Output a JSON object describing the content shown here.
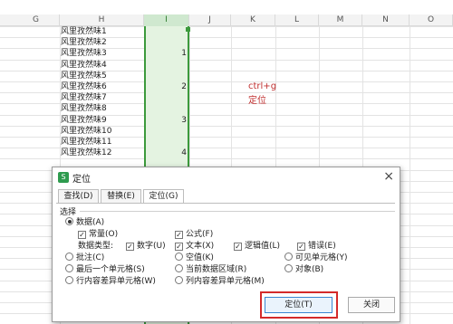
{
  "columns": [
    "G",
    "H",
    "I",
    "J",
    "K",
    "L",
    "M",
    "N",
    "O"
  ],
  "selected_column": "I",
  "h_cells": [
    "风里孜然味1",
    "风里孜然味2",
    "风里孜然味3",
    "风里孜然味4",
    "风里孜然味5",
    "风里孜然味6",
    "风里孜然味7",
    "风里孜然味8",
    "风里孜然味9",
    "风里孜然味10",
    "风里孜然味11",
    "风里孜然味12"
  ],
  "i_cells": [
    {
      "row": 3,
      "value": "1"
    },
    {
      "row": 6,
      "value": "2"
    },
    {
      "row": 9,
      "value": "3"
    },
    {
      "row": 12,
      "value": "4"
    }
  ],
  "notes": [
    "ctrl+g",
    "定位"
  ],
  "dialog": {
    "title": "定位",
    "close": "×",
    "tabs": [
      "查找(D)",
      "替换(E)",
      "定位(G)"
    ],
    "active_tab": "定位(G)",
    "section": "选择",
    "options": {
      "data": "数据(A)",
      "constant": "常量(O)",
      "formula": "公式(F)",
      "data_type_label": "数据类型:",
      "number": "数字(U)",
      "text": "文本(X)",
      "logical": "逻辑值(L)",
      "error": "错误(E)",
      "comment": "批注(C)",
      "blank": "空值(K)",
      "visible": "可见单元格(Y)",
      "last_cell": "最后一个单元格(S)",
      "current_region": "当前数据区域(R)",
      "objects": "对象(B)",
      "row_diff": "行内容差异单元格(W)",
      "col_diff": "列内容差异单元格(M)"
    },
    "buttons": {
      "locate": "定位(T)",
      "close": "关闭"
    }
  },
  "colors": {
    "selection": "#3c9a3c",
    "highlight": "#d42a2a",
    "note": "#c03030"
  }
}
